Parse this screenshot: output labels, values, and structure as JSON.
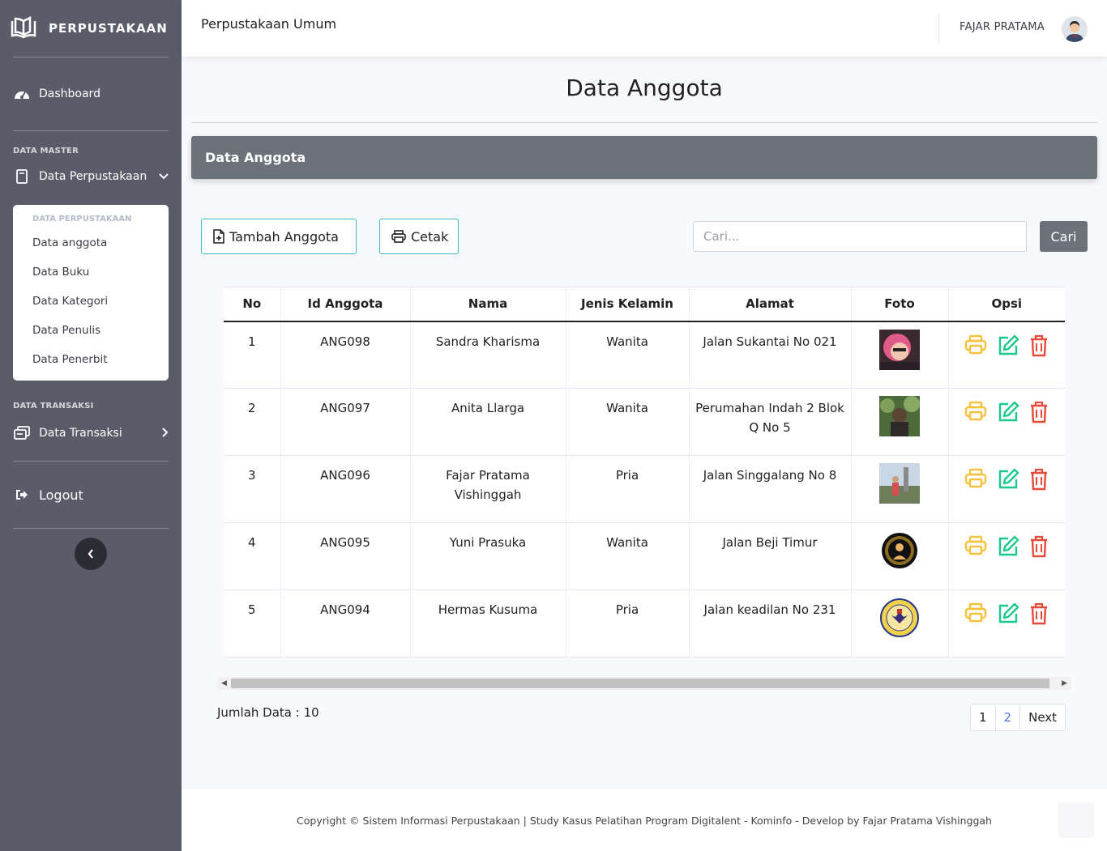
{
  "brand": {
    "name": "PERPUSTAKAAN",
    "icon": "open-book-icon"
  },
  "sidebar": {
    "dashboard": "Dashboard",
    "heading_master": "DATA MASTER",
    "data_perpustakaan": "Data Perpustakaan",
    "submenu": {
      "heading": "DATA PERPUSTAKAAN",
      "items": [
        "Data anggota",
        "Data Buku",
        "Data Kategori",
        "Data Penulis",
        "Data Penerbit"
      ]
    },
    "heading_transaksi": "DATA TRANSAKSI",
    "data_transaksi": "Data Transaksi",
    "logout": "Logout",
    "toggle_icon": "chevron-left-icon"
  },
  "topbar": {
    "title": "Perpustakaan Umum",
    "user": "FAJAR PRATAMA"
  },
  "page": {
    "title": "Data Anggota",
    "card_title": "Data Anggota",
    "add_button": "Tambah Anggota",
    "print_button": "Cetak",
    "search_placeholder": "Cari...",
    "search_button": "Cari"
  },
  "table": {
    "headers": [
      "No",
      "Id Anggota",
      "Nama",
      "Jenis Kelamin",
      "Alamat",
      "Foto",
      "Opsi"
    ],
    "rows": [
      {
        "no": "1",
        "id": "ANG098",
        "nama": "Sandra Kharisma",
        "jk": "Wanita",
        "alamat": "Jalan Sukantai No 021"
      },
      {
        "no": "2",
        "id": "ANG097",
        "nama": "Anita Llarga",
        "jk": "Wanita",
        "alamat": "Perumahan Indah 2 Blok Q No 5"
      },
      {
        "no": "3",
        "id": "ANG096",
        "nama": "Fajar Pratama Vishinggah",
        "jk": "Pria",
        "alamat": "Jalan Singgalang No 8"
      },
      {
        "no": "4",
        "id": "ANG095",
        "nama": "Yuni Prasuka",
        "jk": "Wanita",
        "alamat": "Jalan Beji Timur"
      },
      {
        "no": "5",
        "id": "ANG094",
        "nama": "Hermas Kusuma",
        "jk": "Pria",
        "alamat": "Jalan keadilan No 231"
      }
    ]
  },
  "colors": {
    "print": "#f6c23e",
    "edit": "#1cc88a",
    "delete": "#e74a3b"
  },
  "summary": {
    "total": "Jumlah Data : 10"
  },
  "pagination": {
    "pages": [
      "1",
      "2"
    ],
    "next": "Next"
  },
  "footer": {
    "text": "Copyright © Sistem Informasi Perpustakaan | Study Kasus Pelatihan Program Digitalent - Kominfo - Develop by Fajar Pratama Vishinggah"
  }
}
